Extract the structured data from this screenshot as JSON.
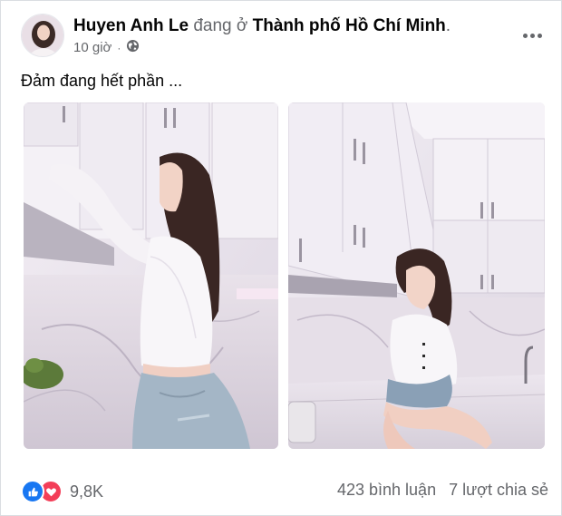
{
  "post": {
    "author": "Huyen Anh Le",
    "verb": "đang ở",
    "place": "Thành phố Hồ Chí Minh",
    "place_suffix": ".",
    "time": "10 giờ",
    "privacy_icon": "globe-icon",
    "caption": "Đảm đang hết phần ...",
    "photos": [
      {
        "label": "kitchen-photo-left"
      },
      {
        "label": "kitchen-photo-right"
      }
    ],
    "reactions": {
      "icons": [
        "like-icon",
        "love-icon"
      ],
      "count": "9,8K"
    },
    "comments": "423 bình luận",
    "shares": "7 lượt chia sẻ"
  },
  "colors": {
    "like": "#1877f2",
    "love": "#f33e58",
    "secondary_text": "#65676b"
  }
}
